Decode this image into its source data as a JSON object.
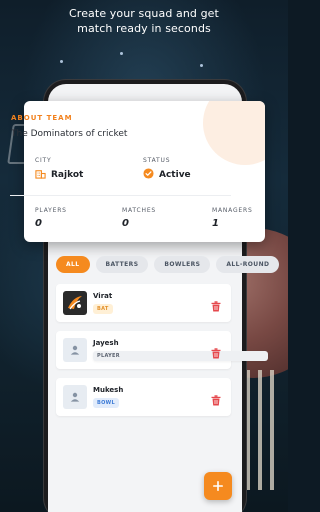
{
  "tagline": {
    "line1": "Create your squad and get",
    "line2": "match ready in seconds"
  },
  "team": {
    "section_title": "ABOUT TEAM",
    "name": "The Dominators of cricket",
    "city_label": "CITY",
    "city": "Rajkot",
    "status_label": "STATUS",
    "status": "Active",
    "players_label": "PLAYERS",
    "players": "0",
    "matches_label": "MATCHES",
    "matches": "0",
    "managers_label": "MANAGERS",
    "managers": "1"
  },
  "filters": [
    "ALL",
    "BATTERS",
    "BOWLERS",
    "ALL-ROUND"
  ],
  "active_filter": "ALL",
  "players": [
    {
      "name": "Virat",
      "role": "BAT",
      "avatar": "team-logo-icon"
    },
    {
      "name": "Jayesh",
      "role": "PLAYER",
      "avatar": "user-icon"
    },
    {
      "name": "Mukesh",
      "role": "BOWL",
      "avatar": "user-icon"
    }
  ],
  "colors": {
    "accent": "#f58a1f",
    "delete": "#e5484d",
    "card": "#ffffff",
    "screen_bg": "#f3f4f6"
  },
  "icons": {
    "city": "building-icon",
    "status": "check-badge-icon",
    "delete": "trash-icon",
    "add": "plus-icon"
  }
}
